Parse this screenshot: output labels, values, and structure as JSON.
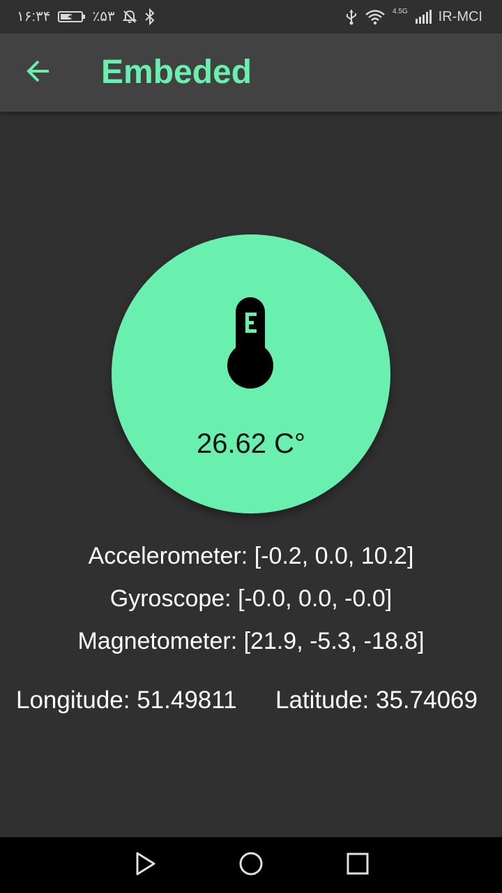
{
  "status_bar": {
    "time": "۱۶:۳۴",
    "battery_percent": "٪۵۳",
    "network_type": "4.5G",
    "carrier": "IR-MCI",
    "icons": [
      "battery-charging-icon",
      "notifications-off-icon",
      "bluetooth-icon",
      "usb-icon",
      "wifi-icon",
      "signal-icon"
    ]
  },
  "app_bar": {
    "title": "Embeded",
    "back_icon": "arrow-back-icon"
  },
  "temperature": {
    "icon": "thermometer-icon",
    "value": "26.62 C°"
  },
  "sensors": {
    "accelerometer": {
      "label": "Accelerometer: ",
      "value": "[-0.2, 0.0, 10.2]"
    },
    "gyroscope": {
      "label": "Gyroscope: ",
      "value": "[-0.0, 0.0, -0.0]"
    },
    "magnetometer": {
      "label": "Magnetometer: ",
      "value": "[21.9, -5.3, -18.8]"
    }
  },
  "location": {
    "longitude_label": "Longitude: ",
    "longitude_value": "51.49811",
    "latitude_label": "Latitude: ",
    "latitude_value": "35.74069"
  },
  "nav_bar": {
    "icons": [
      "back-triangle-icon",
      "home-circle-icon",
      "recents-square-icon"
    ]
  },
  "colors": {
    "accent": "#69f0ae",
    "background": "#303030",
    "app_bar": "#424242",
    "nav_bar": "#000000",
    "text": "#ffffff"
  }
}
